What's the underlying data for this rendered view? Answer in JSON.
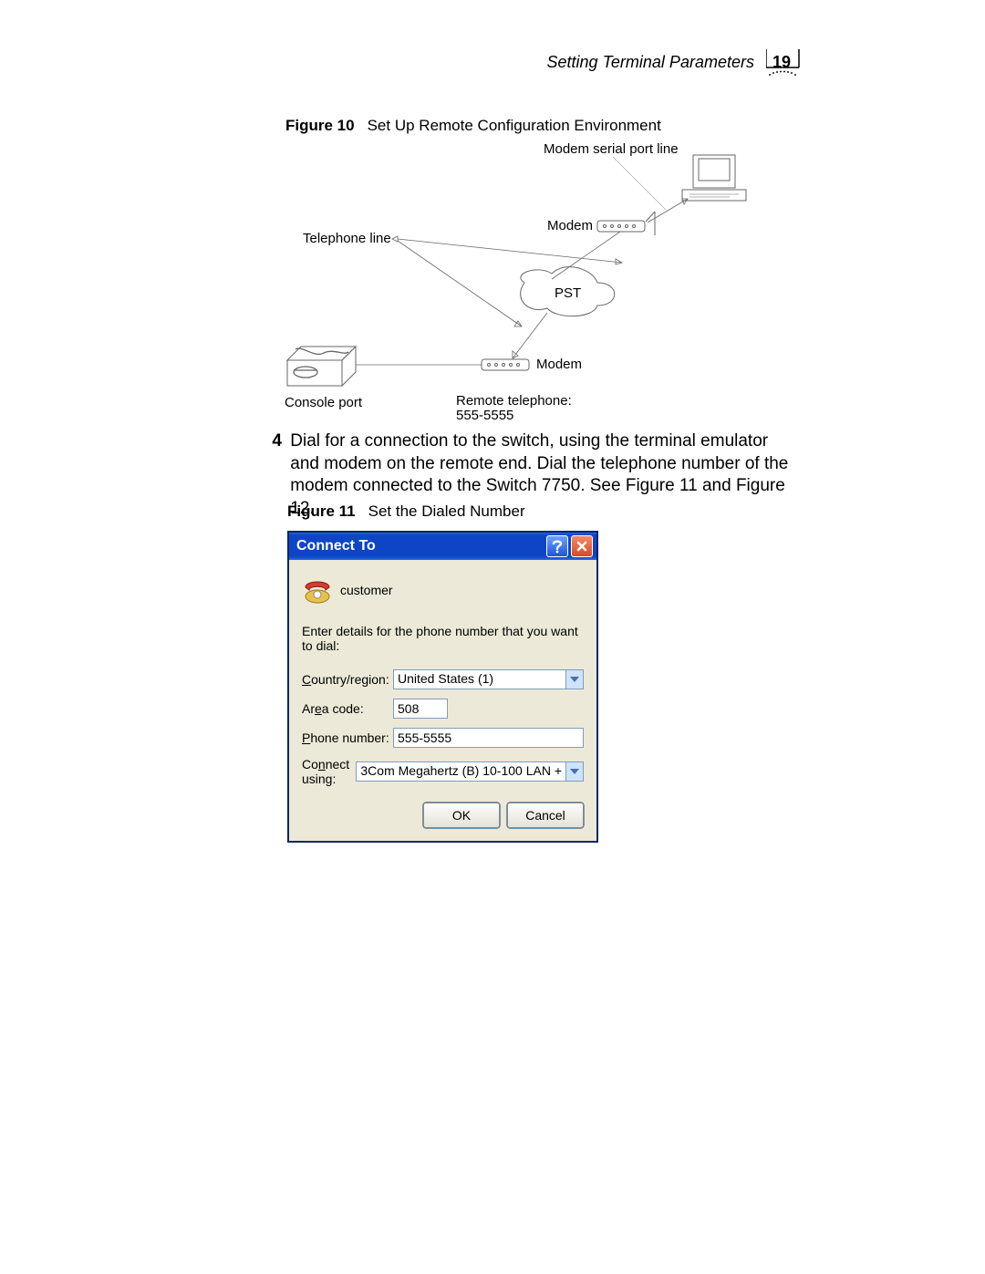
{
  "header": {
    "section_title": "Setting Terminal Parameters",
    "page_number": "19"
  },
  "figure10": {
    "caption_prefix": "Figure 10",
    "caption_text": "Set Up Remote Configuration Environment",
    "labels": {
      "modem_serial": "Modem serial port line",
      "modem_top": "Modem",
      "telephone_line": "Telephone line",
      "pst": "PST",
      "modem_bottom": "Modem",
      "console_port": "Console port",
      "remote_phone_l1": "Remote telephone:",
      "remote_phone_l2": "555-5555"
    }
  },
  "step4": {
    "number": "4",
    "text": "Dial for a connection to the switch, using the terminal emulator and modem on the remote end. Dial the telephone number of the modem connected to the Switch 7750. See Figure 11 and Figure 12."
  },
  "figure11": {
    "caption_prefix": "Figure 11",
    "caption_text": "Set the Dialed Number"
  },
  "dialog": {
    "title": "Connect To",
    "connection_name": "customer",
    "instruction": "Enter details for the phone number that you want to dial:",
    "fields": {
      "country_label": "Country/region:",
      "country_value": "United States (1)",
      "area_label": "Area code:",
      "area_value": "508",
      "phone_label": "Phone number:",
      "phone_value": "555-5555",
      "connect_label": "Connect using:",
      "connect_value": "3Com Megahertz (B) 10-100 LAN +"
    },
    "buttons": {
      "ok": "OK",
      "cancel": "Cancel"
    }
  }
}
